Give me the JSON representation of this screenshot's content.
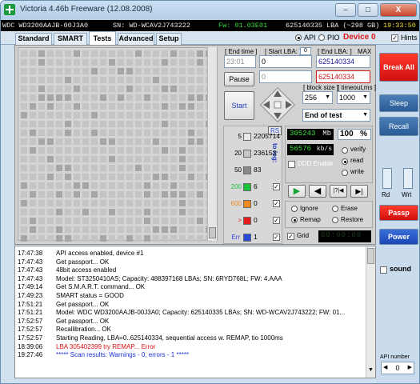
{
  "window": {
    "title": "Victoria 4.46b Freeware (12.08.2008)",
    "caption_buttons": {
      "minimize": "–",
      "maximize": "□",
      "close": "X"
    }
  },
  "status_bar": {
    "model": "WDC WD3200AAJB-00J3A0",
    "serial": "SN: WD-WCAV2J743222",
    "firmware": "Fw: 01.03E01",
    "lba_total": "625140335 LBA (~298 GB)",
    "clock": "19:33:50"
  },
  "tabs": [
    {
      "label": "Standard",
      "active": false
    },
    {
      "label": "SMART",
      "active": false
    },
    {
      "label": "Tests",
      "active": true
    },
    {
      "label": "Advanced",
      "active": false
    },
    {
      "label": "Setup",
      "active": false
    }
  ],
  "mode": {
    "api_label": "API",
    "pio_label": "PIO",
    "api_selected": true,
    "device_label": "Device 0",
    "hints_label": "Hints",
    "hints_checked": true
  },
  "test_controls": {
    "end_time_label": "[ End time ]",
    "end_time_value": "23:01",
    "start_lba_label": "[ Start LBA: ]",
    "start_lba_spin": "0",
    "start_lba_value": "0",
    "end_lba_label": "[ End LBA: ]",
    "end_lba_max": "MAX",
    "end_lba_value": "625140334",
    "secondary_value": "0",
    "secondary_lba_value": "625140334",
    "pause_label": "Pause",
    "start_label": "Start",
    "block_size_label": "[ block size ]",
    "block_size_value": "256",
    "timeout_label": "[ timeout,ms ]",
    "timeout_value": "1000",
    "end_action_value": "End of test"
  },
  "counters": {
    "rs_label": "RS",
    "to_log_label": "to log:",
    "rows": [
      {
        "label": "5",
        "value": "2205714",
        "color": "#e8e8e8"
      },
      {
        "label": "20",
        "value": "236153",
        "color": "#c4c4c4"
      },
      {
        "label": "50",
        "value": "83",
        "color": "#8a8a8a"
      },
      {
        "label": "200",
        "value": "6",
        "color": "#19c23a"
      },
      {
        "label": "600",
        "value": "0",
        "color": "#f08a1d"
      },
      {
        "label": ">",
        "value": "0",
        "color": "#e31b1b"
      },
      {
        "label": "Err",
        "value": "1",
        "color": "#2a49d6"
      }
    ]
  },
  "progress": {
    "mb_value": "305243",
    "mb_unit": "Mb",
    "percent": "100",
    "percent_unit": "%",
    "speed_value": "56576",
    "speed_unit": "kb/s",
    "ddd_label": "DDD Enable",
    "verify_label": "verify",
    "read_label": "read",
    "write_label": "write",
    "selected_mode": "read"
  },
  "actions": {
    "ignore_label": "Ignore",
    "erase_label": "Erase",
    "remap_label": "Remap",
    "restore_label": "Restore",
    "selected": "Remap",
    "grid_label": "Grid",
    "grid_checked": true,
    "timer": "00:00:00"
  },
  "transport": [
    {
      "name": "play",
      "glyph": "▶"
    },
    {
      "name": "back",
      "glyph": "◀"
    },
    {
      "name": "skip",
      "glyph": "|?|◀"
    },
    {
      "name": "end",
      "glyph": "▶|"
    }
  ],
  "side": {
    "break_all": "Break All",
    "sleep": "Sleep",
    "recall": "Recall",
    "rd": "Rd",
    "wrt": "Wrt",
    "passp": "Passp",
    "power": "Power",
    "sound": "sound",
    "api_number_label": "API number",
    "api_number_value": "0"
  },
  "log": [
    {
      "time": "17:47:38",
      "msg": "API access enabled, device #1",
      "color": "#000000"
    },
    {
      "time": "17:47:43",
      "msg": "Get passport... OK",
      "color": "#000000"
    },
    {
      "time": "17:47:43",
      "msg": "48bit access enabled",
      "color": "#000000"
    },
    {
      "time": "17:47:43",
      "msg": "Model: ST3250410AS; Capacity: 488397168 LBAs; SN: 6RYD768L; FW: 4.AAA",
      "color": "#000000"
    },
    {
      "time": "17:49:14",
      "msg": "Get S.M.A.R.T. command... OK",
      "color": "#000000"
    },
    {
      "time": "17:49:23",
      "msg": "SMART status = GOOD",
      "color": "#000000"
    },
    {
      "time": "17:51:21",
      "msg": "Get passport... OK",
      "color": "#000000"
    },
    {
      "time": "17:51:21",
      "msg": "Model: WDC WD3200AAJB-00J3A0; Capacity: 625140335 LBAs; SN: WD-WCAV2J743222; FW: 01...",
      "color": "#000000"
    },
    {
      "time": "17:52:57",
      "msg": "Get passport... OK",
      "color": "#000000"
    },
    {
      "time": "17:52:57",
      "msg": "Recallibration... OK",
      "color": "#000000"
    },
    {
      "time": "17:52:57",
      "msg": "Starting Reading, LBA=0..625140334, sequential access w. REMAP, tio 1000ms",
      "color": "#000000"
    },
    {
      "time": "18:39:06",
      "msg": "LBA 305402399 try REMAP... Error",
      "color": "#e01010"
    },
    {
      "time": "19:27:46",
      "msg": "***** Scan results: Warnings - 0, errors - 1 *****",
      "color": "#1a2fd0"
    }
  ]
}
